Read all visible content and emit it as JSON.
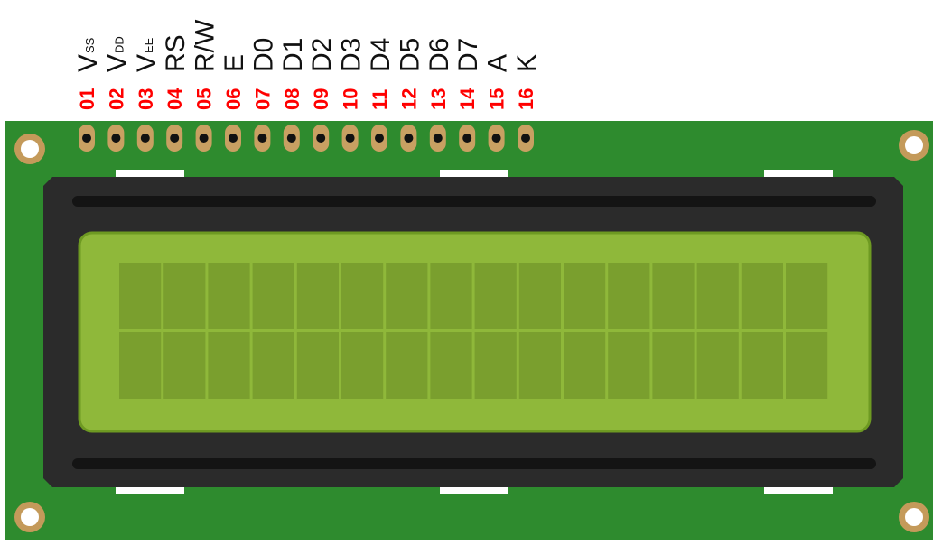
{
  "colors": {
    "pcb": "#2e8b2e",
    "pcb_edge": "#236e23",
    "bezel": "#2b2b2b",
    "bezel_dark": "#141414",
    "screen": "#8fb83a",
    "screen_edge": "#6e9a22",
    "cell": "#7a9f2e",
    "pin_number": "#ff0000",
    "header_pad": "#c8a062",
    "mount_hole": "#c49a5a"
  },
  "pins": [
    {
      "number": "01",
      "name": "V",
      "sub": "SS"
    },
    {
      "number": "02",
      "name": "V",
      "sub": "DD"
    },
    {
      "number": "03",
      "name": "V",
      "sub": "EE"
    },
    {
      "number": "04",
      "name": "RS",
      "sub": ""
    },
    {
      "number": "05",
      "name": "R/W",
      "sub": ""
    },
    {
      "number": "06",
      "name": "E",
      "sub": ""
    },
    {
      "number": "07",
      "name": "D0",
      "sub": ""
    },
    {
      "number": "08",
      "name": "D1",
      "sub": ""
    },
    {
      "number": "09",
      "name": "D2",
      "sub": ""
    },
    {
      "number": "10",
      "name": "D3",
      "sub": ""
    },
    {
      "number": "11",
      "name": "D4",
      "sub": ""
    },
    {
      "number": "12",
      "name": "D5",
      "sub": ""
    },
    {
      "number": "13",
      "name": "D6",
      "sub": ""
    },
    {
      "number": "14",
      "name": "D7",
      "sub": ""
    },
    {
      "number": "15",
      "name": "A",
      "sub": ""
    },
    {
      "number": "16",
      "name": "K",
      "sub": ""
    }
  ],
  "display": {
    "rows": 2,
    "columns": 16
  }
}
